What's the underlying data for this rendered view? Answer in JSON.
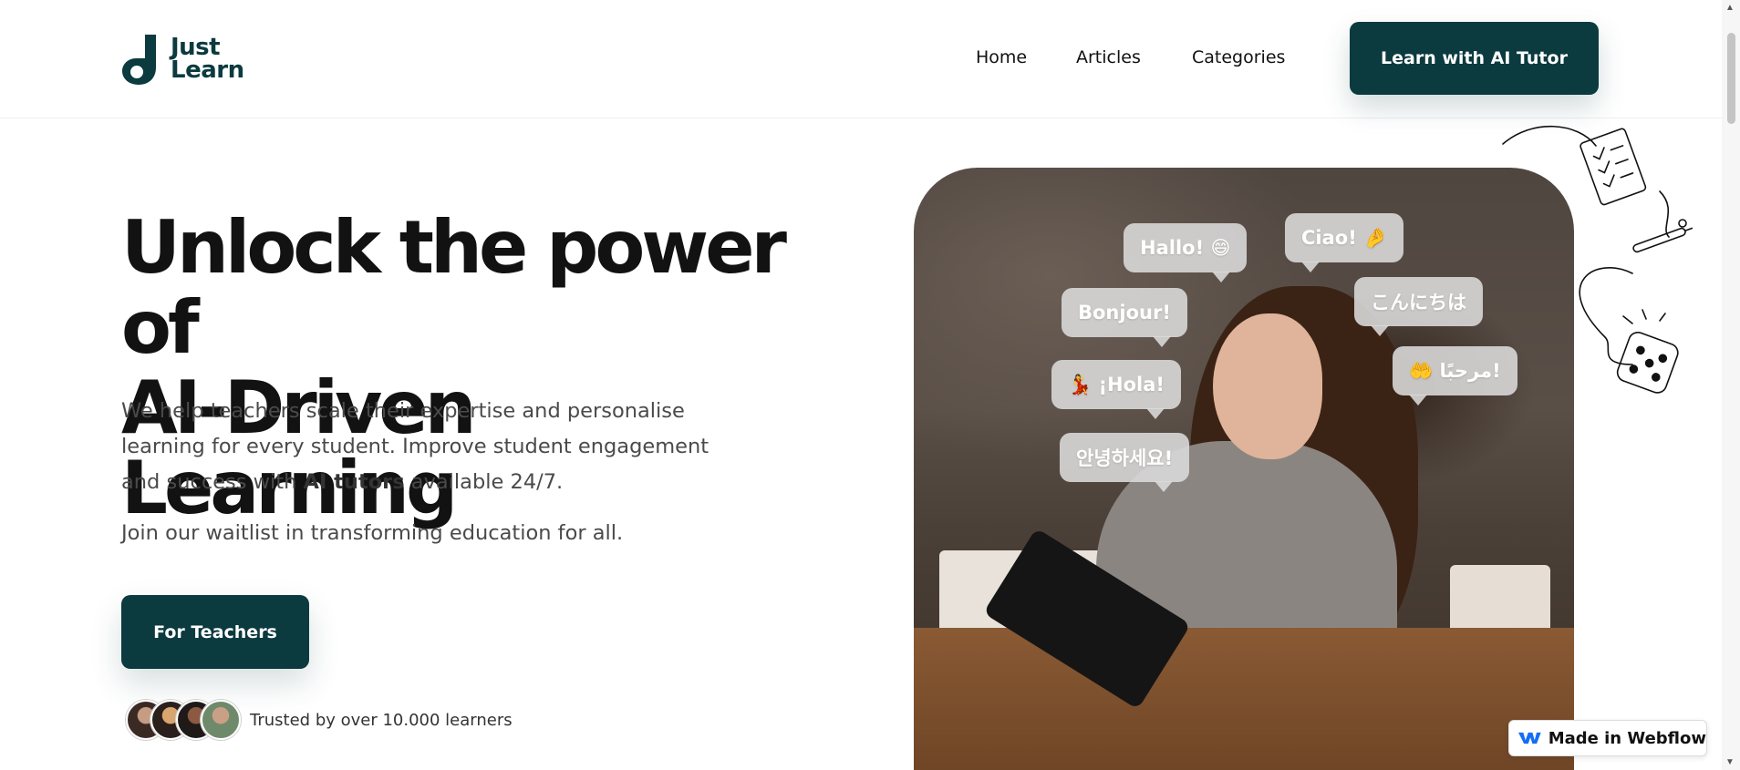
{
  "brand": {
    "line1": "Just",
    "line2": "Learn",
    "color": "#0b3a3f"
  },
  "nav": {
    "items": [
      {
        "label": "Home"
      },
      {
        "label": "Articles"
      },
      {
        "label": "Categories"
      }
    ],
    "cta": "Learn with AI Tutor"
  },
  "hero": {
    "title_line1": "Unlock the power of",
    "title_line2": "AI-Driven Learning",
    "desc_part1": "We help teachers scale their expertise and personalise learning for every student. Improve student engagement and success with ",
    "desc_bold": "AI tutors",
    "desc_part2": " available 24/7.",
    "join": "Join our waitlist in transforming education for all.",
    "button": "For Teachers",
    "trust": "Trusted by over 10.000 learners"
  },
  "bubbles": [
    {
      "text": "Hallo! 😄"
    },
    {
      "text": "Ciao! 🤌"
    },
    {
      "text": "Bonjour!"
    },
    {
      "text": "こんにちは"
    },
    {
      "text": "💃 ¡Hola!"
    },
    {
      "text": "🤲 مرحبًا!"
    },
    {
      "text": "안녕하세요!"
    }
  ],
  "badge": {
    "text": "Made in Webflow",
    "color": "#146ef5"
  },
  "colors": {
    "primary": "#0b3a3f",
    "text": "#121212",
    "muted": "#4a4a4a"
  }
}
